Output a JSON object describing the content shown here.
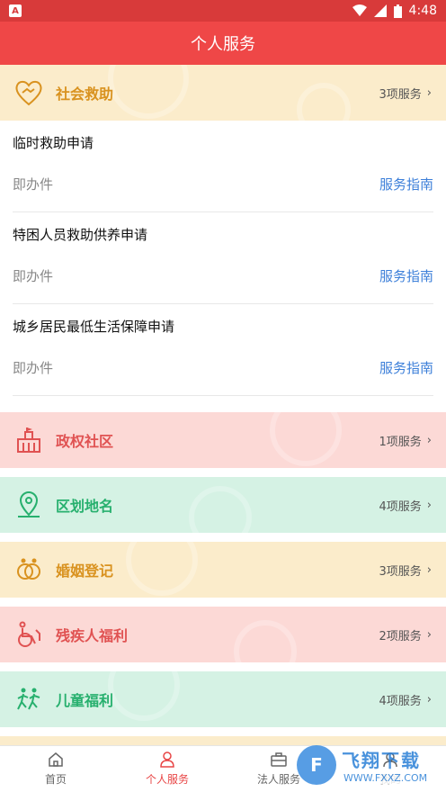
{
  "status_bar": {
    "time": "4:48",
    "app_badge": "A"
  },
  "header": {
    "title": "个人服务"
  },
  "categories": [
    {
      "name": "社会救助",
      "count": "3项服务",
      "theme": "yellow",
      "icon": "handshake-icon",
      "expanded": true,
      "items": [
        {
          "title": "临时救助申请",
          "type": "即办件",
          "guide": "服务指南"
        },
        {
          "title": "特困人员救助供养申请",
          "type": "即办件",
          "guide": "服务指南"
        },
        {
          "title": "城乡居民最低生活保障申请",
          "type": "即办件",
          "guide": "服务指南"
        }
      ]
    },
    {
      "name": "政权社区",
      "count": "1项服务",
      "theme": "red",
      "icon": "building-icon"
    },
    {
      "name": "区划地名",
      "count": "4项服务",
      "theme": "green",
      "icon": "map-pin-icon"
    },
    {
      "name": "婚姻登记",
      "count": "3项服务",
      "theme": "yellow",
      "icon": "rings-icon"
    },
    {
      "name": "残疾人福利",
      "count": "2项服务",
      "theme": "red",
      "icon": "wheelchair-icon"
    },
    {
      "name": "儿童福利",
      "count": "4项服务",
      "theme": "green",
      "icon": "children-icon"
    }
  ],
  "tabs": [
    {
      "label": "首页",
      "icon": "home-icon",
      "active": false
    },
    {
      "label": "个人服务",
      "icon": "person-icon",
      "active": true
    },
    {
      "label": "法人服务",
      "icon": "briefcase-icon",
      "active": false
    },
    {
      "label": "我的",
      "icon": "profile-icon",
      "active": false
    }
  ],
  "watermark": {
    "logo": "F",
    "name": "飞翔下载",
    "url": "WWW.FXXZ.COM"
  },
  "colors": {
    "header": "#ef4747",
    "yellow": "#d9921f",
    "red": "#e05252",
    "green": "#27b06e",
    "link": "#3c7fd9"
  }
}
